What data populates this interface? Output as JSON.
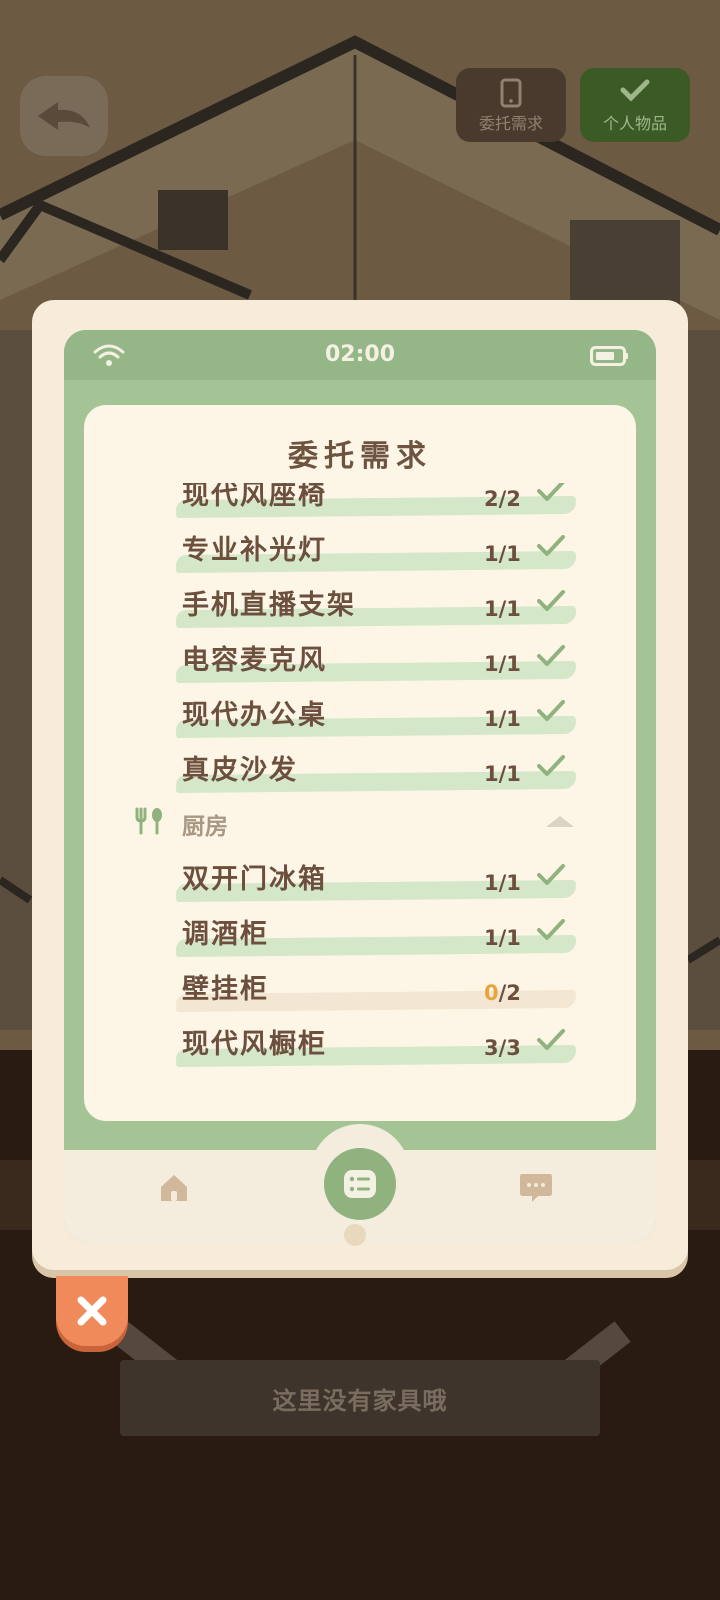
{
  "top_buttons": {
    "requests_label": "委托需求",
    "items_label": "个人物品"
  },
  "phone": {
    "time": "02:00",
    "card_title": "委托需求",
    "items": [
      {
        "name": "现代风座椅",
        "done": "2",
        "total": "2",
        "status": "complete"
      },
      {
        "name": "专业补光灯",
        "done": "1",
        "total": "1",
        "status": "complete"
      },
      {
        "name": "手机直播支架",
        "done": "1",
        "total": "1",
        "status": "complete"
      },
      {
        "name": "电容麦克风",
        "done": "1",
        "total": "1",
        "status": "complete"
      },
      {
        "name": "现代办公桌",
        "done": "1",
        "total": "1",
        "status": "complete"
      },
      {
        "name": "真皮沙发",
        "done": "1",
        "total": "1",
        "status": "complete"
      }
    ],
    "kitchen_section": {
      "label": "厨房",
      "icon": "fork-spoon-icon",
      "expanded": true,
      "items": [
        {
          "name": "双开门冰箱",
          "done": "1",
          "total": "1",
          "status": "complete"
        },
        {
          "name": "调酒柜",
          "done": "1",
          "total": "1",
          "status": "complete"
        },
        {
          "name": "壁挂柜",
          "done": "0",
          "total": "2",
          "status": "pending"
        },
        {
          "name": "现代风橱柜",
          "done": "3",
          "total": "3",
          "status": "complete"
        }
      ]
    },
    "nav": [
      "home-icon",
      "list-icon",
      "chat-icon"
    ]
  },
  "empty_message": "这里没有家具哦",
  "colors": {
    "check": "#8fb27e",
    "pending_count": "#e7a43d",
    "close": "#f08a5a"
  }
}
